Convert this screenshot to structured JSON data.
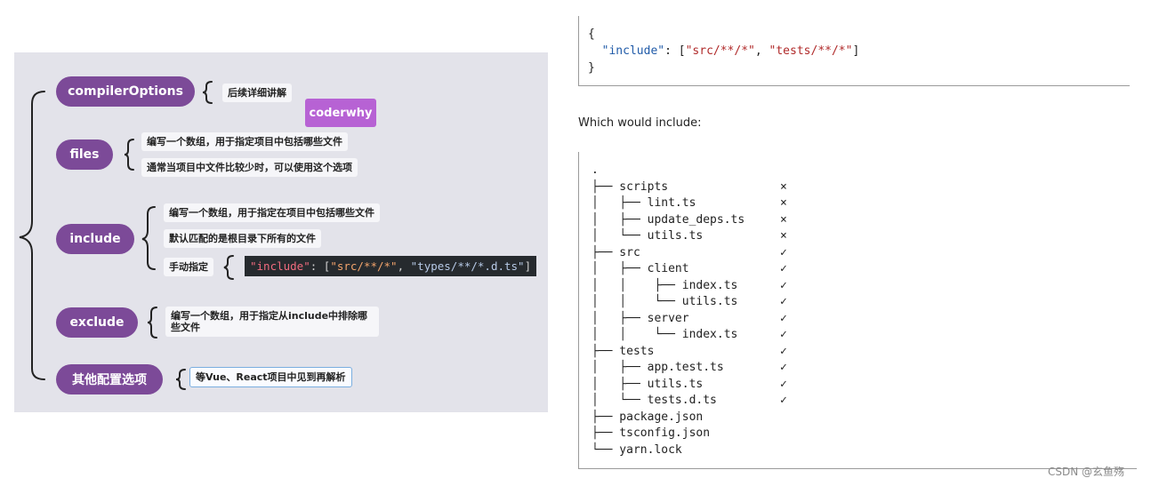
{
  "mindmap": {
    "badge": "coderwhy",
    "nodes": {
      "compiler": "compilerOptions",
      "files": "files",
      "include": "include",
      "exclude": "exclude",
      "other": "其他配置选项"
    },
    "leaves": {
      "compiler": "后续详细讲解",
      "files_1": "编写一个数组，用于指定项目中包括哪些文件",
      "files_2": "通常当项目中文件比较少时，可以使用这个选项",
      "include_1": "编写一个数组，用于指定在项目中包括哪些文件",
      "include_2": "默认匹配的是根目录下所有的文件",
      "include_3": "手动指定",
      "exclude_1": "编写一个数组，用于指定从include中排除哪些文件",
      "other_1": "等Vue、React项目中见到再解析"
    },
    "code": {
      "key": "\"include\"",
      "colon": ": [",
      "str1": "\"src/**/*\"",
      "comma": ", ",
      "str2": "\"types/**/*.d.ts\"",
      "close": "]"
    }
  },
  "config_code": {
    "open": "{",
    "key": "\"include\"",
    "mid": ": [",
    "val1": "\"src/**/*\"",
    "sep": ", ",
    "val2": "\"tests/**/*\"",
    "end": "]",
    "close": "}"
  },
  "caption": "Which would include:",
  "tree": [
    {
      "text": ".",
      "mark": ""
    },
    {
      "text": "├── scripts",
      "mark": "×"
    },
    {
      "text": "│   ├── lint.ts",
      "mark": "×"
    },
    {
      "text": "│   ├── update_deps.ts",
      "mark": "×"
    },
    {
      "text": "│   └── utils.ts",
      "mark": "×"
    },
    {
      "text": "├── src",
      "mark": "✓"
    },
    {
      "text": "│   ├── client",
      "mark": "✓"
    },
    {
      "text": "│   │    ├── index.ts",
      "mark": "✓"
    },
    {
      "text": "│   │    └── utils.ts",
      "mark": "✓"
    },
    {
      "text": "│   ├── server",
      "mark": "✓"
    },
    {
      "text": "│   │    └── index.ts",
      "mark": "✓"
    },
    {
      "text": "├── tests",
      "mark": "✓"
    },
    {
      "text": "│   ├── app.test.ts",
      "mark": "✓"
    },
    {
      "text": "│   ├── utils.ts",
      "mark": "✓"
    },
    {
      "text": "│   └── tests.d.ts",
      "mark": "✓"
    },
    {
      "text": "├── package.json",
      "mark": ""
    },
    {
      "text": "├── tsconfig.json",
      "mark": ""
    },
    {
      "text": "└── yarn.lock",
      "mark": ""
    }
  ],
  "watermark": "CSDN @玄鱼殇",
  "colors": {
    "node": "#7c4a98",
    "badge": "#b762d4",
    "panel": "#e3e3ea"
  }
}
